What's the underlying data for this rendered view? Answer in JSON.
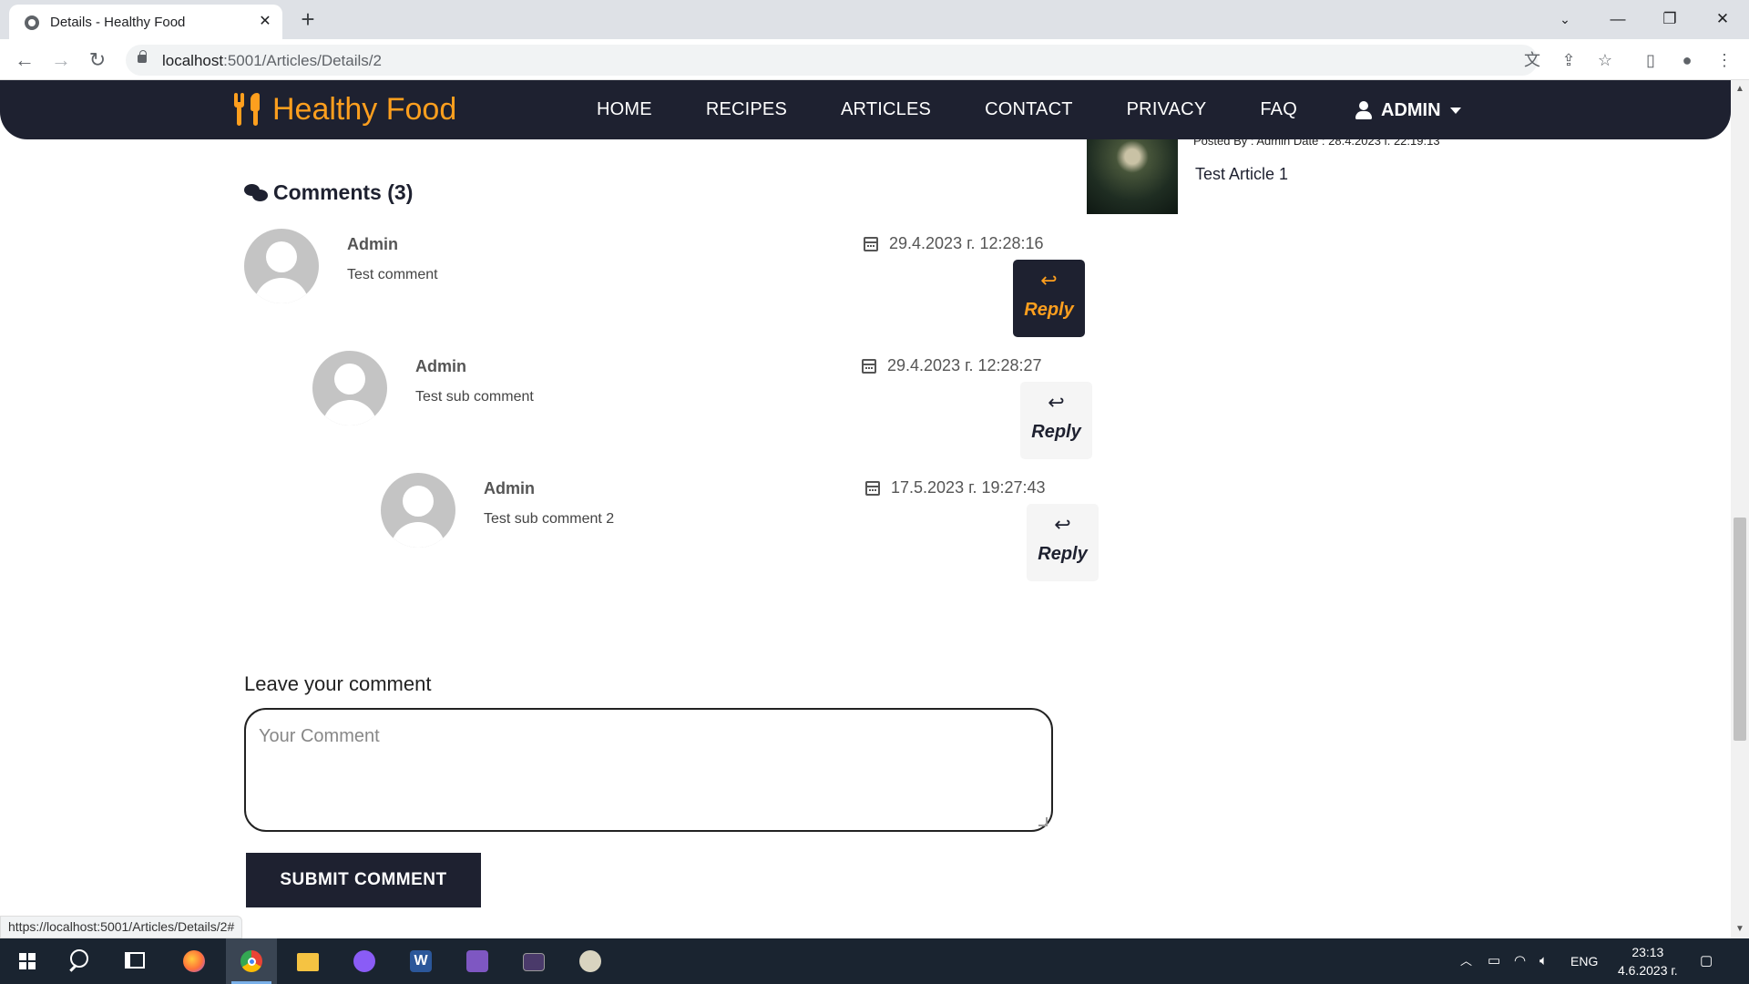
{
  "browser": {
    "tab_title": "Details - Healthy Food",
    "url_host": "localhost",
    "url_rest": ":5001/Articles/Details/2",
    "status_url": "https://localhost:5001/Articles/Details/2#"
  },
  "site": {
    "brand": "Healthy Food",
    "nav": [
      "HOME",
      "RECIPES",
      "ARTICLES",
      "CONTACT",
      "PRIVACY",
      "FAQ"
    ],
    "user_menu": "ADMIN",
    "accent_color": "#fe9f1e",
    "dark_color": "#1e2130"
  },
  "sidebar": {
    "meta": "Posted By : Admin   Date : 28.4.2023 г. 22:19:13",
    "article_title": "Test Article 1"
  },
  "comments": {
    "heading": "Comments (3)",
    "items": [
      {
        "author": "Admin",
        "text": "Test comment",
        "date": "29.4.2023 г. 12:28:16",
        "reply_label": "Reply"
      },
      {
        "author": "Admin",
        "text": "Test sub comment",
        "date": "29.4.2023 г. 12:28:27",
        "reply_label": "Reply"
      },
      {
        "author": "Admin",
        "text": "Test sub comment 2",
        "date": "17.5.2023 г. 19:27:43",
        "reply_label": "Reply"
      }
    ]
  },
  "form": {
    "title": "Leave your comment",
    "placeholder": "Your Comment",
    "submit_label": "SUBMIT COMMENT"
  },
  "taskbar": {
    "language": "ENG",
    "time": "23:13",
    "date": "4.6.2023 г.",
    "apps": [
      "firefox",
      "chrome",
      "file-explorer",
      "github-desktop",
      "word",
      "visual-studio",
      "terminal",
      "paint"
    ]
  }
}
